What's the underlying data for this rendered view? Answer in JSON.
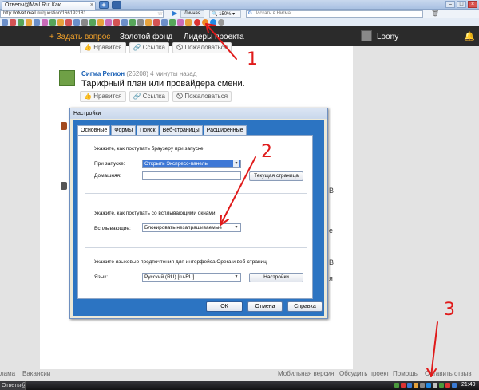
{
  "browser": {
    "tab_title": "Ответы@Mail.Ru: Как ...",
    "tab_close": "×",
    "newtab_plus": "+",
    "url_prefix": "http://",
    "url_domain": "otvet.mail.ru",
    "url_path": "/question/166192181",
    "star_icon": "☆",
    "profile": "Личная",
    "zoom": "150%",
    "search_placeholder": "Искать в Нигма",
    "search_engine_letter": "G",
    "window_buttons": [
      "–",
      "□",
      "×"
    ]
  },
  "site": {
    "ask_button": "+ Задать вопрос",
    "nav": [
      "Золотой фонд",
      "Лидеры проекта"
    ],
    "username": "Loony"
  },
  "answer": {
    "top_actions": [
      "Нравится",
      "Ссылка",
      "Пожаловаться"
    ],
    "author": "Сигма Регион",
    "score": "(26208)",
    "time": "4 минуты назад",
    "text": "Тарифный план или провайдера смени.",
    "actions": [
      "Нравится",
      "Ссылка",
      "Пожаловаться"
    ]
  },
  "side_fragments": [
    "В",
    "е",
    "В",
    "я"
  ],
  "footer": {
    "left_items": [
      "лама",
      "Вакансии"
    ],
    "right_items": [
      "Мобильная версия",
      "Обсудить проект",
      "Помощь",
      "Оставить отзыв"
    ]
  },
  "dialog": {
    "title": "Настройки",
    "tabs": [
      "Основные",
      "Формы",
      "Поиск",
      "Веб-страницы",
      "Расширенные"
    ],
    "startup": {
      "heading": "Укажите, как поступать браузеру при запуске",
      "label": "При запуске:",
      "value": "Открыть Экспресс-панель",
      "home_label": "Домашняя:",
      "home_value": "",
      "current_page_button": "Текущая страница"
    },
    "popups": {
      "heading": "Укажите, как поступать со всплывающими окнами",
      "label": "Всплывающие:",
      "value": "Блокировать незапрашиваемые"
    },
    "language": {
      "heading": "Укажите языковые предпочтения для интерфейса Opera и веб-страниц",
      "label": "Язык:",
      "value": "Русский (RU) [ru-RU]",
      "settings_button": "Настройки"
    },
    "buttons": {
      "ok": "ОК",
      "cancel": "Отмена",
      "help": "Справка"
    }
  },
  "taskbar": {
    "window_label": "Ответы@Mail.Ru: К...",
    "clock": "21:49"
  },
  "annotations": {
    "marks": [
      "1",
      "2",
      "3"
    ],
    "color": "#e01b1b"
  },
  "colors": {
    "site_header": "#2b2b2b",
    "ask_accent": "#f4a32a",
    "dialog_blue": "#2c74c2",
    "selected_option": "#3e78d6"
  }
}
